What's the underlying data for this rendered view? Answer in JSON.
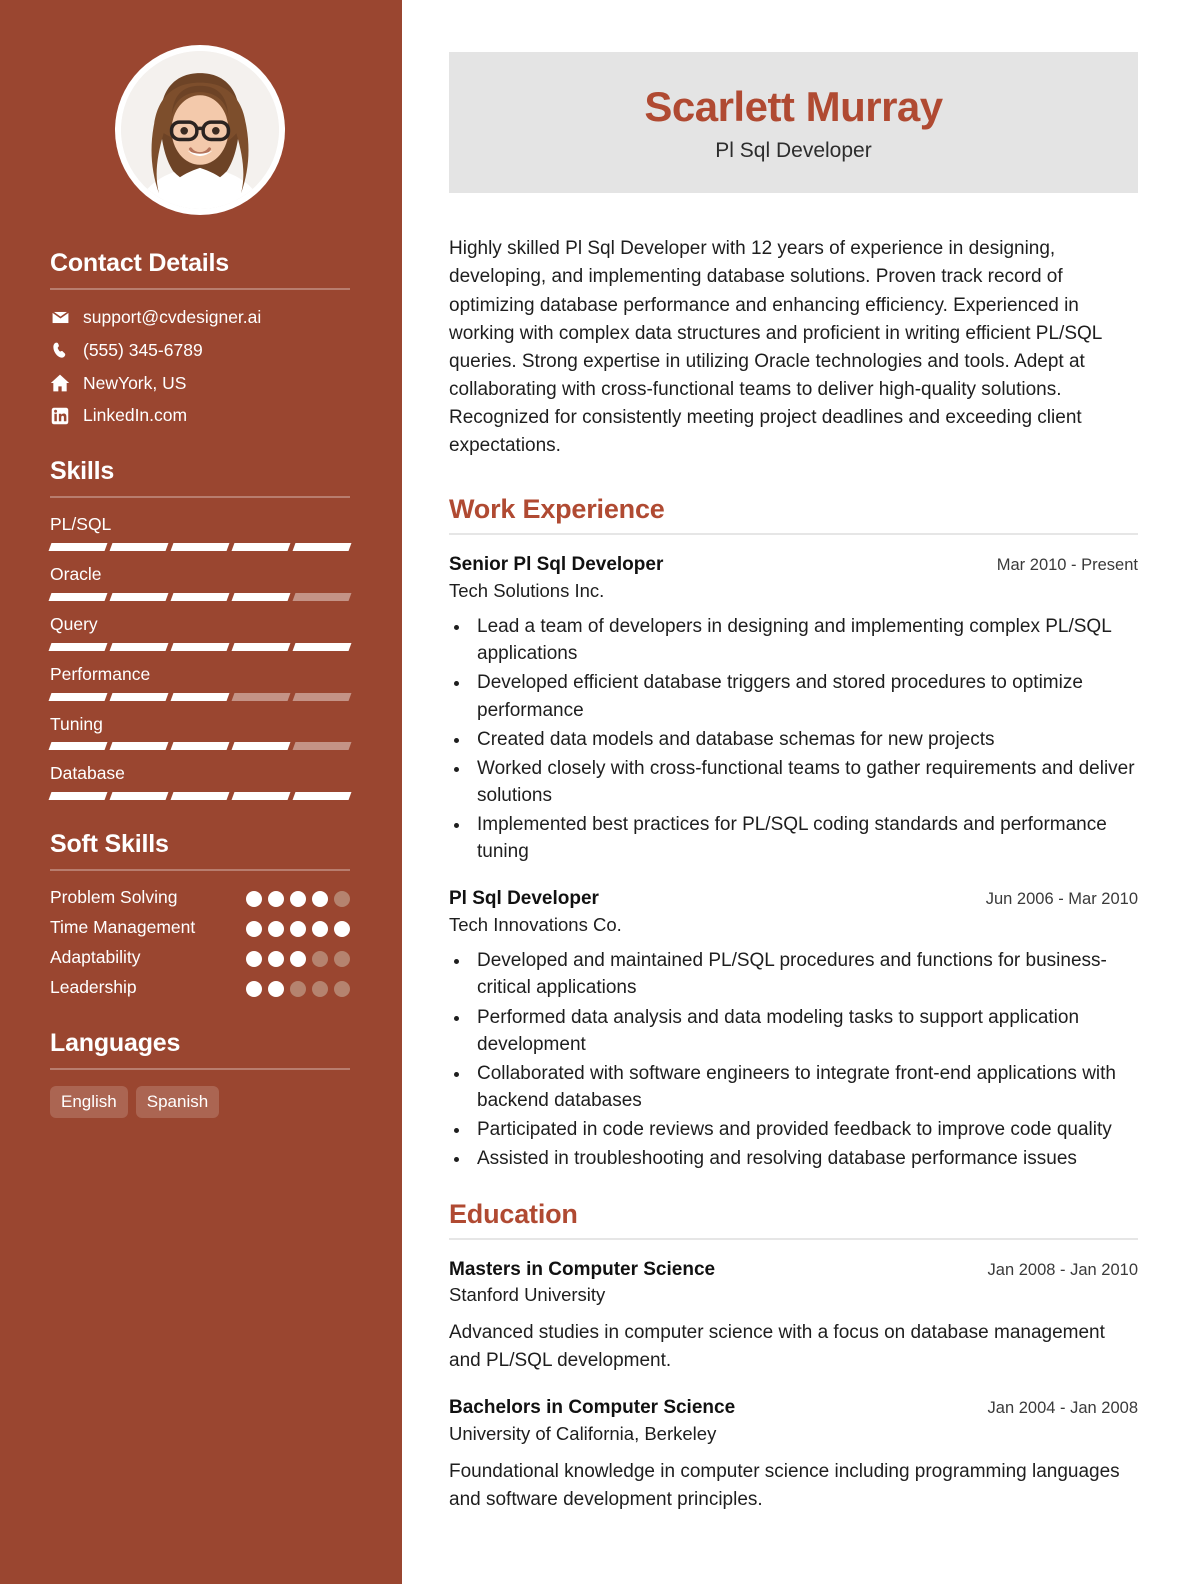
{
  "sidebar": {
    "avatar_alt": "profile-photo",
    "contact": {
      "heading": "Contact Details",
      "items": [
        {
          "icon": "email-icon",
          "value": "support@cvdesigner.ai"
        },
        {
          "icon": "phone-icon",
          "value": "(555) 345-6789"
        },
        {
          "icon": "home-icon",
          "value": "NewYork, US"
        },
        {
          "icon": "linkedin-icon",
          "value": "LinkedIn.com"
        }
      ]
    },
    "skills": {
      "heading": "Skills",
      "max": 5,
      "items": [
        {
          "label": "PL/SQL",
          "level": 5
        },
        {
          "label": "Oracle",
          "level": 4
        },
        {
          "label": "Query",
          "level": 5
        },
        {
          "label": "Performance",
          "level": 3
        },
        {
          "label": "Tuning",
          "level": 4
        },
        {
          "label": "Database",
          "level": 5
        }
      ]
    },
    "soft_skills": {
      "heading": "Soft Skills",
      "max": 5,
      "items": [
        {
          "label": "Problem Solving",
          "level": 4
        },
        {
          "label": "Time Management",
          "level": 5
        },
        {
          "label": "Adaptability",
          "level": 3
        },
        {
          "label": "Leadership",
          "level": 2
        }
      ]
    },
    "languages": {
      "heading": "Languages",
      "items": [
        "English",
        "Spanish"
      ]
    }
  },
  "header": {
    "name": "Scarlett Murray",
    "title": "Pl Sql Developer"
  },
  "summary": "Highly skilled Pl Sql Developer with 12 years of experience in designing, developing, and implementing database solutions. Proven track record of optimizing database performance and enhancing efficiency. Experienced in working with complex data structures and proficient in writing efficient PL/SQL queries. Strong expertise in utilizing Oracle technologies and tools. Adept at collaborating with cross-functional teams to deliver high-quality solutions. Recognized for consistently meeting project deadlines and exceeding client expectations.",
  "work": {
    "heading": "Work Experience",
    "entries": [
      {
        "role": "Senior Pl Sql Developer",
        "date": "Mar 2010 - Present",
        "org": "Tech Solutions Inc.",
        "bullets": [
          "Lead a team of developers in designing and implementing complex PL/SQL applications",
          "Developed efficient database triggers and stored procedures to optimize performance",
          "Created data models and database schemas for new projects",
          "Worked closely with cross-functional teams to gather requirements and deliver solutions",
          "Implemented best practices for PL/SQL coding standards and performance tuning"
        ]
      },
      {
        "role": "Pl Sql Developer",
        "date": "Jun 2006 - Mar 2010",
        "org": "Tech Innovations Co.",
        "bullets": [
          "Developed and maintained PL/SQL procedures and functions for business-critical applications",
          "Performed data analysis and data modeling tasks to support application development",
          "Collaborated with software engineers to integrate front-end applications with backend databases",
          "Participated in code reviews and provided feedback to improve code quality",
          "Assisted in troubleshooting and resolving database performance issues"
        ]
      }
    ]
  },
  "education": {
    "heading": "Education",
    "entries": [
      {
        "degree": "Masters in Computer Science",
        "date": "Jan 2008 - Jan 2010",
        "school": "Stanford University",
        "description": "Advanced studies in computer science with a focus on database management and PL/SQL development."
      },
      {
        "degree": "Bachelors in Computer Science",
        "date": "Jan 2004 - Jan 2008",
        "school": "University of California, Berkeley",
        "description": "Foundational knowledge in computer science including programming languages and software development principles."
      }
    ]
  },
  "colors": {
    "sidebar_bg": "#9a4630",
    "accent": "#b04a32",
    "banner_bg": "#e4e4e4",
    "dot_empty": "#b5836f"
  }
}
